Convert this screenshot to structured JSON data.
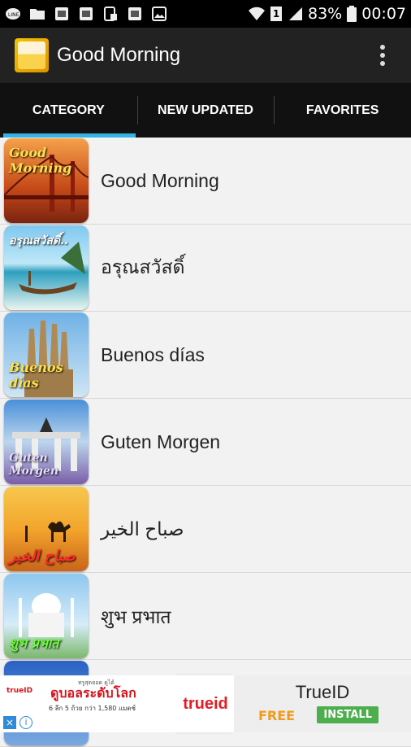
{
  "status_bar": {
    "battery_percent": "83%",
    "time": "00:07",
    "sim_label": "1"
  },
  "app_bar": {
    "title": "Good Morning",
    "logo_text": "Good Morning"
  },
  "tabs": [
    {
      "label": "CATEGORY",
      "active": true
    },
    {
      "label": "NEW UPDATED",
      "active": false
    },
    {
      "label": "FAVORITES",
      "active": false
    }
  ],
  "categories": [
    {
      "label": "Good Morning",
      "thumb_caption": "Good Morning"
    },
    {
      "label": "อรุณสวัสดิ์",
      "thumb_caption": "อรุณสวัสดิ์.."
    },
    {
      "label": "Buenos días",
      "thumb_caption": "Buenos días"
    },
    {
      "label": "Guten Morgen",
      "thumb_caption": "Guten Morgen"
    },
    {
      "label": "صباح الخير",
      "thumb_caption": "صباح الخير"
    },
    {
      "label": "शुभ प्रभात",
      "thumb_caption": "शुभ प्रभात"
    }
  ],
  "ad": {
    "left_headline": "ดูบอลระดับโลก",
    "left_small": "6 ลีก 5 ถ้วย กว่า 1,580 แมตช์",
    "left_tag": "trueID",
    "left_top": "ทรูสุดยอด ดูได้",
    "brand": "trueid",
    "app_name": "TrueID",
    "price": "FREE",
    "cta": "INSTALL",
    "close_icon": "×",
    "info_icon": "i"
  },
  "colors": {
    "accent_tab_indicator": "#34b3e4",
    "app_bar": "#222222",
    "tab_bar": "#111111"
  }
}
